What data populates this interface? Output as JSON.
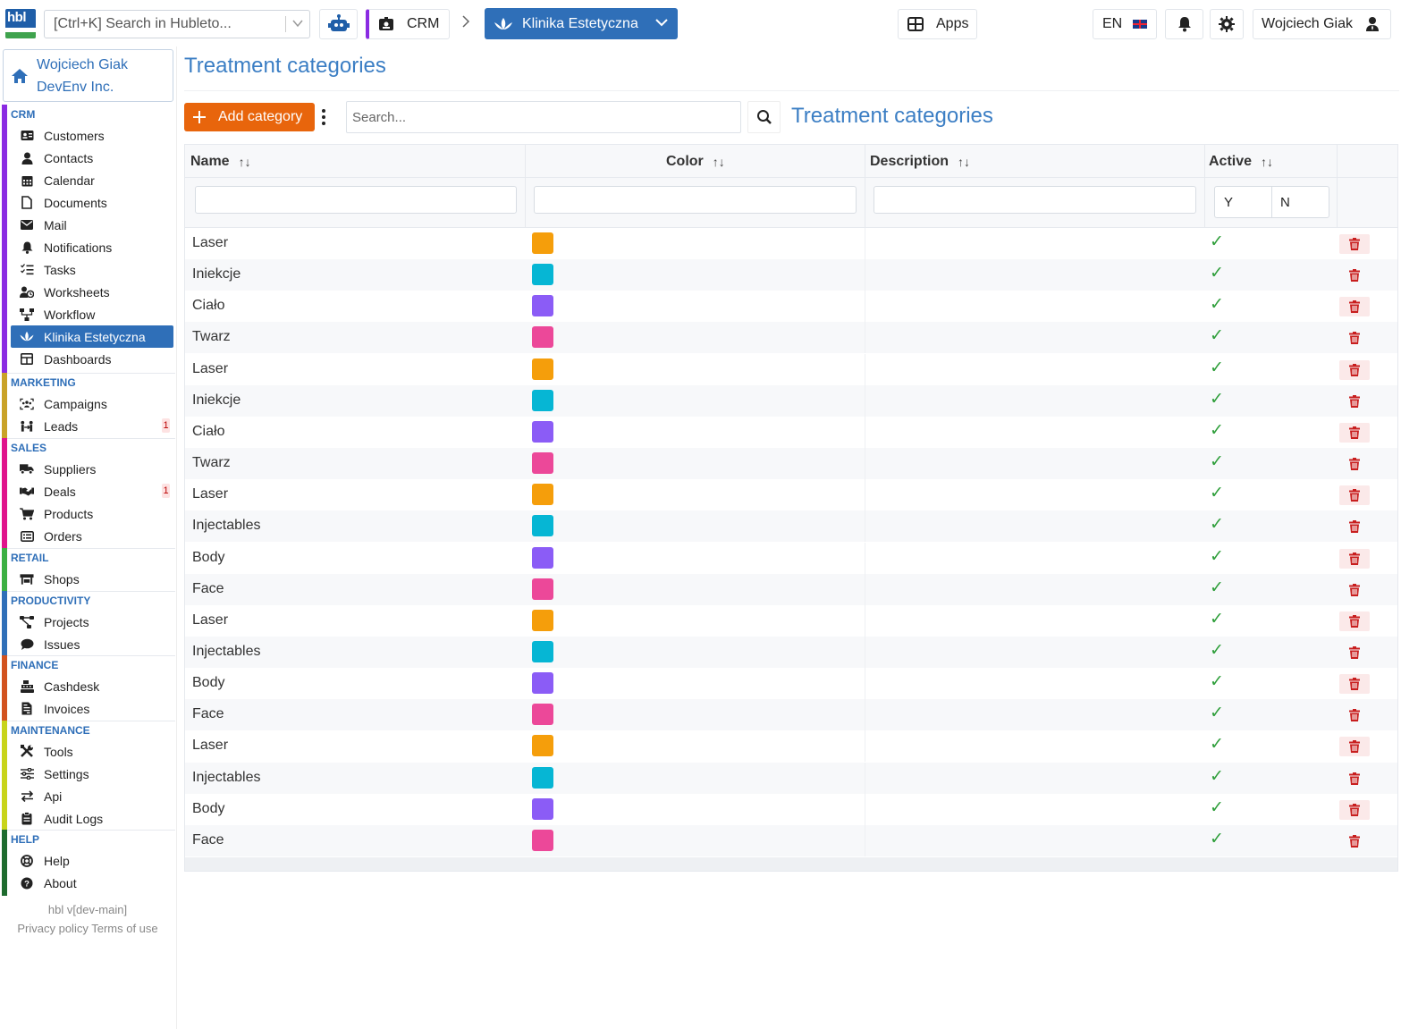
{
  "app": {
    "logo_text": "hbl",
    "search_placeholder": "[Ctrl+K] Search in Hubleto...",
    "breadcrumb_module": "CRM",
    "breadcrumb_app": "Klinika Estetyczna",
    "apps_label": "Apps",
    "language": "EN",
    "user_name": "Wojciech Giak"
  },
  "org": {
    "user": "Wojciech Giak",
    "company": "DevEnv Inc."
  },
  "sidebar": {
    "groups": [
      {
        "title": "CRM",
        "color": "#8a2be2",
        "items": [
          {
            "label": "Customers",
            "icon": "id-card-icon"
          },
          {
            "label": "Contacts",
            "icon": "person-icon"
          },
          {
            "label": "Calendar",
            "icon": "calendar-icon"
          },
          {
            "label": "Documents",
            "icon": "document-icon"
          },
          {
            "label": "Mail",
            "icon": "envelope-icon"
          },
          {
            "label": "Notifications",
            "icon": "bell-icon"
          },
          {
            "label": "Tasks",
            "icon": "tasks-icon"
          },
          {
            "label": "Worksheets",
            "icon": "user-clock-icon"
          },
          {
            "label": "Workflow",
            "icon": "workflow-icon"
          },
          {
            "label": "Klinika Estetyczna",
            "icon": "lotus-icon",
            "active": true
          },
          {
            "label": "Dashboards",
            "icon": "dashboard-icon"
          }
        ]
      },
      {
        "title": "MARKETING",
        "color": "#c9a227",
        "items": [
          {
            "label": "Campaigns",
            "icon": "campaign-icon"
          },
          {
            "label": "Leads",
            "icon": "leads-icon",
            "badge": "1"
          }
        ]
      },
      {
        "title": "SALES",
        "color": "#e0148c",
        "items": [
          {
            "label": "Suppliers",
            "icon": "truck-icon"
          },
          {
            "label": "Deals",
            "icon": "handshake-icon",
            "badge": "1"
          },
          {
            "label": "Products",
            "icon": "cart-icon"
          },
          {
            "label": "Orders",
            "icon": "orders-icon"
          }
        ]
      },
      {
        "title": "RETAIL",
        "color": "#3cb043",
        "items": [
          {
            "label": "Shops",
            "icon": "shop-icon"
          }
        ]
      },
      {
        "title": "PRODUCTIVITY",
        "color": "#2f6fb8",
        "items": [
          {
            "label": "Projects",
            "icon": "projects-icon"
          },
          {
            "label": "Issues",
            "icon": "comment-icon"
          }
        ]
      },
      {
        "title": "FINANCE",
        "color": "#d2521f",
        "items": [
          {
            "label": "Cashdesk",
            "icon": "cashdesk-icon"
          },
          {
            "label": "Invoices",
            "icon": "invoice-icon"
          }
        ]
      },
      {
        "title": "MAINTENANCE",
        "color": "#c8d41a",
        "items": [
          {
            "label": "Tools",
            "icon": "tools-icon"
          },
          {
            "label": "Settings",
            "icon": "sliders-icon"
          },
          {
            "label": "Api",
            "icon": "arrows-icon"
          },
          {
            "label": "Audit Logs",
            "icon": "clipboard-icon"
          }
        ]
      },
      {
        "title": "HELP",
        "color": "#1e6b2e",
        "items": [
          {
            "label": "Help",
            "icon": "lifebuoy-icon"
          },
          {
            "label": "About",
            "icon": "question-icon"
          }
        ]
      }
    ],
    "version": "hbl v[dev-main]",
    "privacy": "Privacy policy",
    "terms": "Terms of use"
  },
  "page": {
    "title": "Treatment categories",
    "add_button": "Add category",
    "search_placeholder": "Search...",
    "table_title": "Treatment categories"
  },
  "table": {
    "columns": [
      "Name",
      "Color",
      "Description",
      "Active"
    ],
    "active_filter": [
      "Y",
      "N"
    ],
    "rows": [
      {
        "name": "Laser",
        "color": "#f59e0b",
        "active": true
      },
      {
        "name": "Iniekcje",
        "color": "#06b6d4",
        "active": true
      },
      {
        "name": "Ciało",
        "color": "#8b5cf6",
        "active": true
      },
      {
        "name": "Twarz",
        "color": "#ec4899",
        "active": true
      },
      {
        "name": "Laser",
        "color": "#f59e0b",
        "active": true
      },
      {
        "name": "Iniekcje",
        "color": "#06b6d4",
        "active": true
      },
      {
        "name": "Ciało",
        "color": "#8b5cf6",
        "active": true
      },
      {
        "name": "Twarz",
        "color": "#ec4899",
        "active": true
      },
      {
        "name": "Laser",
        "color": "#f59e0b",
        "active": true
      },
      {
        "name": "Injectables",
        "color": "#06b6d4",
        "active": true
      },
      {
        "name": "Body",
        "color": "#8b5cf6",
        "active": true
      },
      {
        "name": "Face",
        "color": "#ec4899",
        "active": true
      },
      {
        "name": "Laser",
        "color": "#f59e0b",
        "active": true
      },
      {
        "name": "Injectables",
        "color": "#06b6d4",
        "active": true
      },
      {
        "name": "Body",
        "color": "#8b5cf6",
        "active": true
      },
      {
        "name": "Face",
        "color": "#ec4899",
        "active": true
      },
      {
        "name": "Laser",
        "color": "#f59e0b",
        "active": true
      },
      {
        "name": "Injectables",
        "color": "#06b6d4",
        "active": true
      },
      {
        "name": "Body",
        "color": "#8b5cf6",
        "active": true
      },
      {
        "name": "Face",
        "color": "#ec4899",
        "active": true
      }
    ]
  }
}
